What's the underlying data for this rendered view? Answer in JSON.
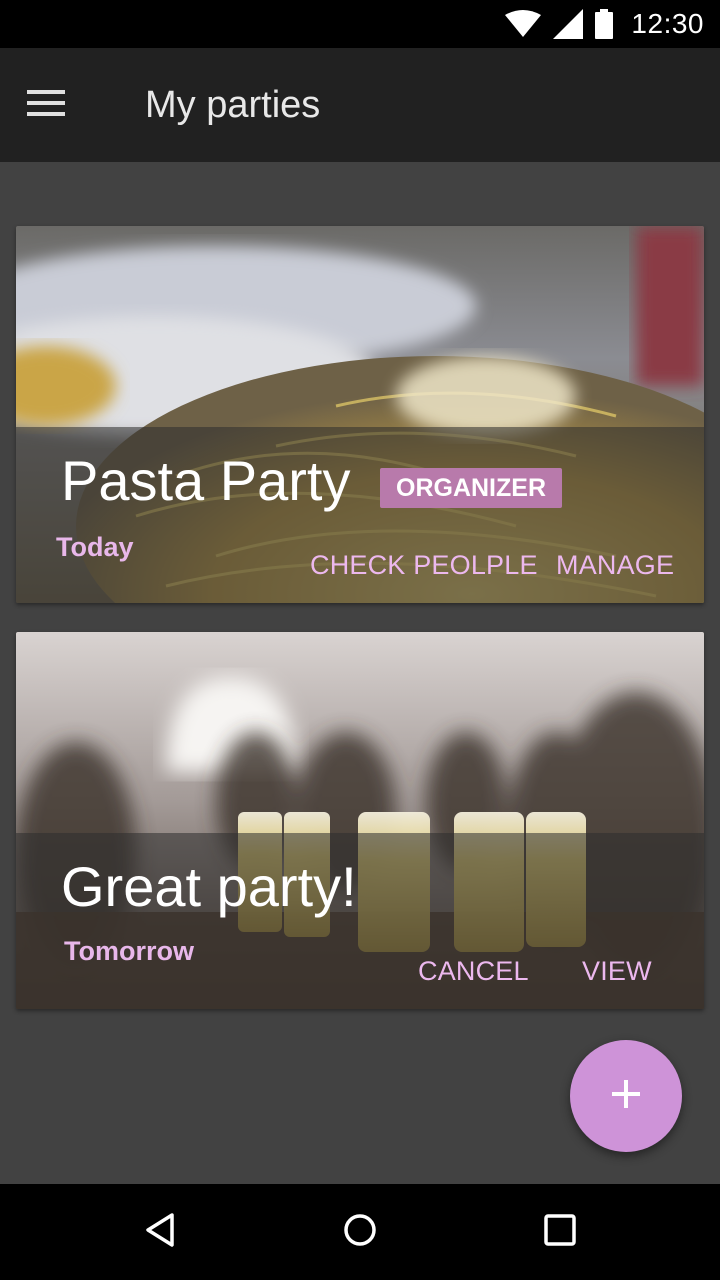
{
  "status_bar": {
    "time": "12:30",
    "icons": [
      "wifi-icon",
      "cell-signal-icon",
      "battery-icon"
    ]
  },
  "app_bar": {
    "menu_icon": "hamburger-menu-icon",
    "title": "My parties"
  },
  "parties": [
    {
      "title": "Pasta Party",
      "badge": "ORGANIZER",
      "date": "Today",
      "actions": [
        "CHECK PEOLPLE",
        "MANAGE"
      ],
      "image": "pasta-photo"
    },
    {
      "title": "Great party!",
      "date": "Tomorrow",
      "actions": [
        "CANCEL",
        "VIEW"
      ],
      "image": "champagne-party-photo"
    }
  ],
  "fab": {
    "icon": "plus-icon"
  },
  "nav_bar": {
    "icons": [
      "back-icon",
      "home-icon",
      "recents-icon"
    ]
  },
  "colors": {
    "accent": "#ce93d8",
    "app_bar": "#212121",
    "background": "#424242",
    "action_text": "#ecb8ee",
    "badge": "#b87aab"
  }
}
